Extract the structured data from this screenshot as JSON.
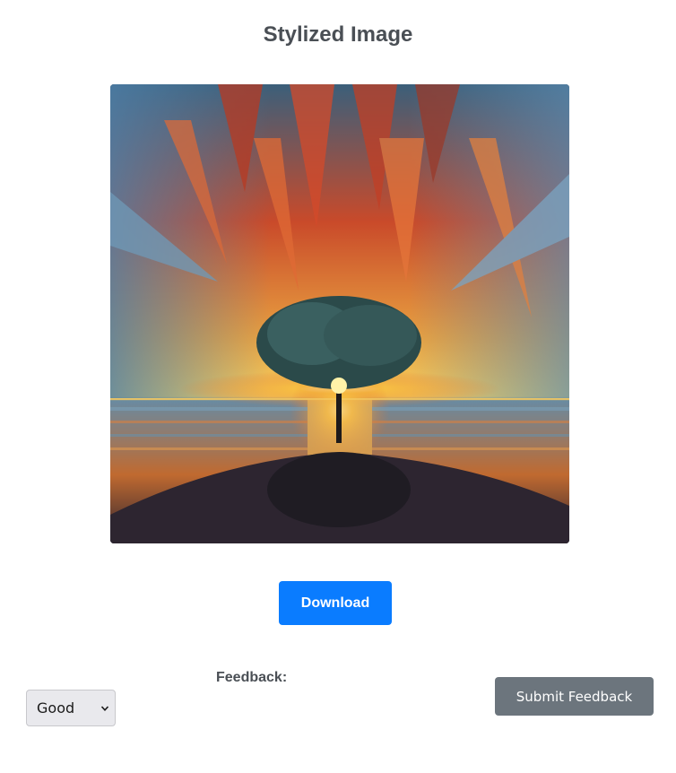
{
  "page": {
    "title": "Stylized Image"
  },
  "image": {
    "alt": "Stylized Image"
  },
  "actions": {
    "download_label": "Download"
  },
  "feedback": {
    "label": "Feedback:",
    "selected": "Good",
    "submit_label": "Submit Feedback"
  },
  "colors": {
    "primary": "#0a7cff",
    "secondary": "#6c757d",
    "heading": "#4a4f55"
  }
}
